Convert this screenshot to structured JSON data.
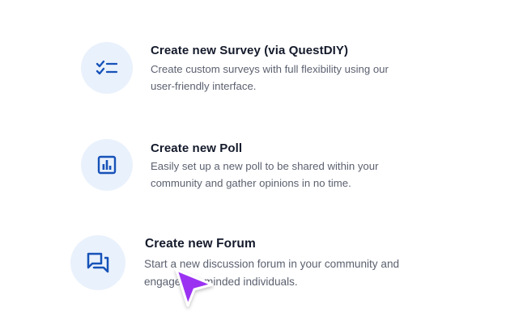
{
  "options": [
    {
      "title": "Create new Survey (via QuestDIY)",
      "line1": "Create custom surveys with full flexibility using our",
      "line2": "user-friendly interface.",
      "icon": "checklist-icon"
    },
    {
      "title": "Create new Poll",
      "line1": "Easily set up a new poll to be shared within your",
      "line2": "community and gather opinions in no time.",
      "icon": "bar-chart-icon"
    },
    {
      "title": "Create new Forum",
      "line1": "Start a new discussion forum in your community and",
      "line2": "engage like-minded individuals.",
      "icon": "chat-bubbles-icon"
    }
  ],
  "colors": {
    "icon_bg": "#e9f1fc",
    "icon_blue": "#1652b8",
    "title": "#141a2b",
    "desc": "#5c6170",
    "cursor": "#9b30f2"
  },
  "cursor_icon": "pointer-cursor-icon"
}
